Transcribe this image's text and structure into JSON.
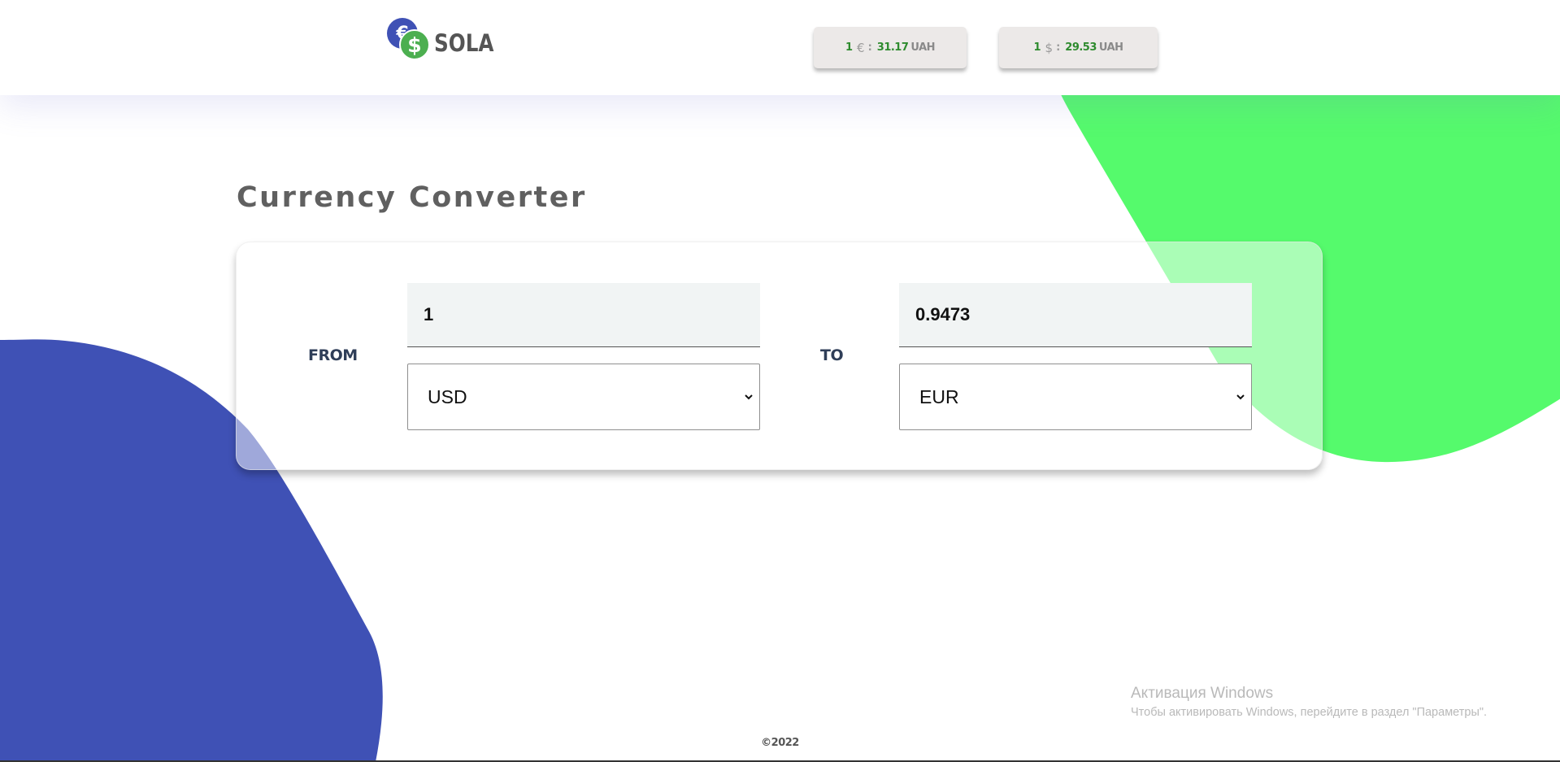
{
  "header": {
    "logo_eur_symbol": "€",
    "logo_usd_symbol": "$",
    "logo_text": "SOLA",
    "rates": [
      {
        "amount": "1",
        "symbol": "€",
        "value": "31.17",
        "currency": "UAH"
      },
      {
        "amount": "1",
        "symbol": "$",
        "value": "29.53",
        "currency": "UAH"
      }
    ]
  },
  "main": {
    "title": "Currency Converter",
    "from_label": "FROM",
    "to_label": "TO",
    "from_amount": "1",
    "to_amount": "0.9473",
    "from_currency": "USD",
    "to_currency": "EUR"
  },
  "watermark": {
    "title": "Активация Windows",
    "subtitle": "Чтобы активировать Windows, перейдите в раздел \"Параметры\"."
  },
  "footer": {
    "copyright": "©2022"
  },
  "colors": {
    "brand_blue": "#3f51b5",
    "brand_green": "#4caf50",
    "blob_green": "#55fa6c",
    "rate_green": "#2e8b2e",
    "title_gray": "#606060"
  },
  "icons": {
    "logo_coin_eur": "euro-coin-icon",
    "logo_coin_usd": "dollar-coin-icon",
    "select_arrow": "chevron-down-icon"
  }
}
